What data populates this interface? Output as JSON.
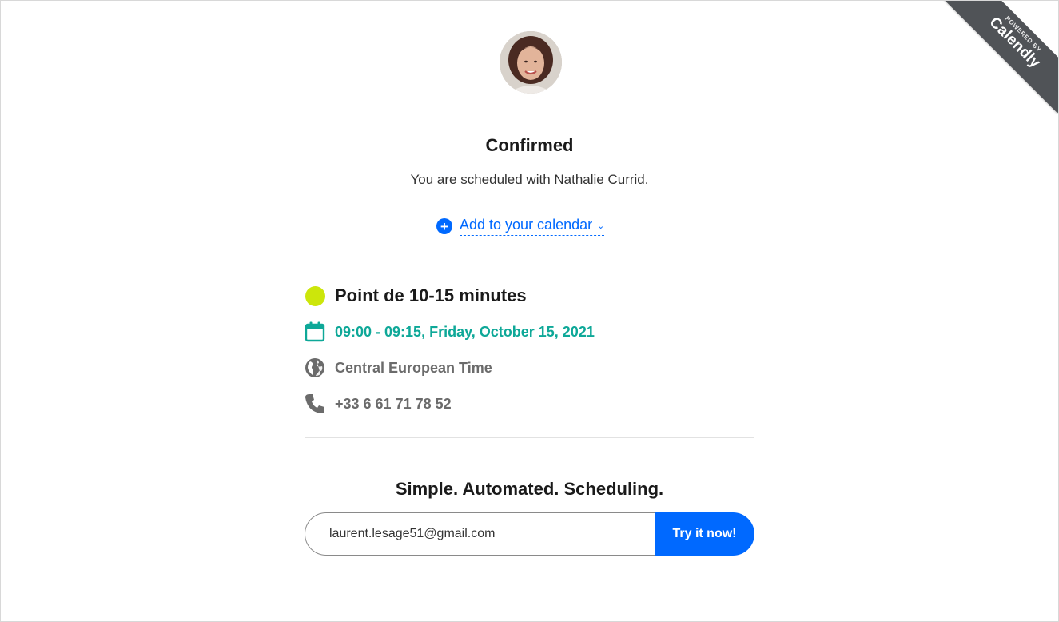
{
  "ribbon": {
    "small_text": "Powered by",
    "brand": "Calendly"
  },
  "header": {
    "title": "Confirmed",
    "subtitle": "You are scheduled with Nathalie Currid.",
    "add_calendar_label": "Add to your calendar"
  },
  "event": {
    "name": "Point de 10-15 minutes",
    "datetime": "09:00 - 09:15, Friday, October 15, 2021",
    "timezone": "Central European Time",
    "phone": "+33 6 61 71 78 52",
    "color": "#cce60b"
  },
  "promo": {
    "title": "Simple. Automated. Scheduling.",
    "email_value": "laurent.lesage51@gmail.com",
    "button_label": "Try it now!"
  },
  "colors": {
    "accent": "#0069ff",
    "datetime": "#0ea898",
    "ribbon": "#505357"
  },
  "icons": {
    "add": "plus-circle-icon",
    "calendar": "calendar-icon",
    "timezone": "globe-icon",
    "phone": "phone-icon"
  }
}
